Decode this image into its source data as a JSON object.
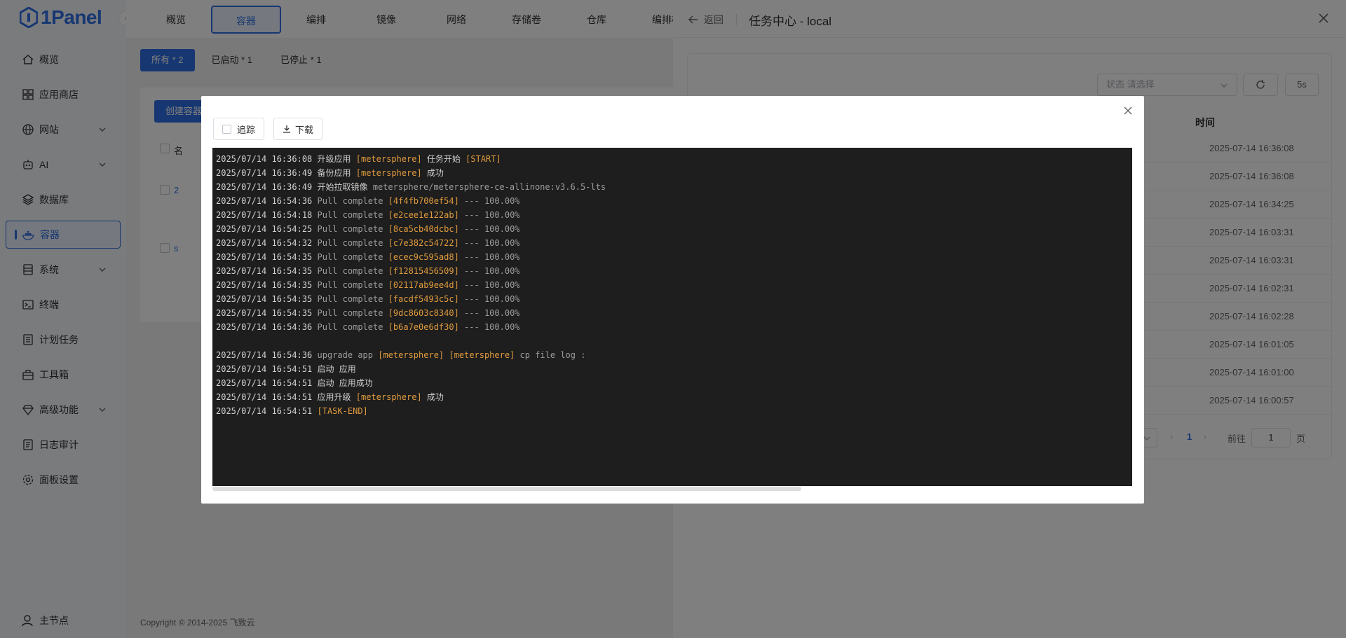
{
  "app": {
    "logo_text": "1Panel",
    "collapse_glyph": "‹"
  },
  "sidebar": {
    "items": [
      {
        "label": "概览",
        "icon": "home-icon"
      },
      {
        "label": "应用商店",
        "icon": "grid-icon"
      },
      {
        "label": "网站",
        "icon": "globe-icon",
        "has_arrow": true
      },
      {
        "label": "AI",
        "icon": "robot-icon",
        "has_arrow": true
      },
      {
        "label": "数据库",
        "icon": "layers-icon"
      },
      {
        "label": "容器",
        "icon": "docker-icon",
        "active": true
      },
      {
        "label": "系统",
        "icon": "server-icon",
        "has_arrow": true
      },
      {
        "label": "终端",
        "icon": "terminal-icon"
      },
      {
        "label": "计划任务",
        "icon": "list-icon"
      },
      {
        "label": "工具箱",
        "icon": "toolbox-icon"
      },
      {
        "label": "高级功能",
        "icon": "diamond-icon",
        "has_arrow": true
      },
      {
        "label": "日志审计",
        "icon": "log-icon"
      },
      {
        "label": "面板设置",
        "icon": "gear-icon"
      }
    ],
    "host_node": "主节点"
  },
  "topnav": {
    "tabs": [
      "概览",
      "容器",
      "编排",
      "镜像",
      "网络",
      "存储卷",
      "仓库",
      "编排模"
    ],
    "active_index": 1
  },
  "filters": {
    "all": "所有 * 2",
    "running": "已启动 * 1",
    "stopped": "已停止 * 1"
  },
  "content": {
    "create_button": "创建容器",
    "col_first": "名",
    "row1_prefix": "2",
    "row2_prefix": "s"
  },
  "footer": {
    "copyright": "Copyright © 2014-2025 飞致云"
  },
  "drawer": {
    "back_label": "返回",
    "title": "任务中心 - local",
    "status_select": "状态  请选择",
    "interval_label": "5s",
    "time_column": "时间",
    "times": [
      "2025-07-14 16:36:08",
      "2025-07-14 16:36:08",
      "2025-07-14 16:34:25",
      "2025-07-14 16:03:31",
      "2025-07-14 16:03:31",
      "2025-07-14 16:02:31",
      "2025-07-14 16:02:28",
      "2025-07-14 16:01:05",
      "2025-07-14 16:01:00",
      "2025-07-14 16:00:57"
    ],
    "pagination": {
      "prev": "‹",
      "current_page": "1",
      "next": "›",
      "goto_label": "前往",
      "goto_value": "1",
      "page_unit": "页"
    }
  },
  "dialog": {
    "follow_label": "追踪",
    "download_label": "下载",
    "log": [
      {
        "ts": "2025/07/14 16:36:08",
        "parts": [
          {
            "t": "升级应用 ",
            "c": "msg-cn"
          },
          {
            "t": "[metersphere]",
            "c": "hl"
          },
          {
            "t": " 任务开始 ",
            "c": "msg-cn"
          },
          {
            "t": "[START]",
            "c": "hl"
          }
        ]
      },
      {
        "ts": "2025/07/14 16:36:49",
        "parts": [
          {
            "t": "备份应用 ",
            "c": "msg-cn"
          },
          {
            "t": "[metersphere]",
            "c": "hl"
          },
          {
            "t": " 成功",
            "c": "msg-cn"
          }
        ]
      },
      {
        "ts": "2025/07/14 16:36:49",
        "parts": [
          {
            "t": "开始拉取镜像 ",
            "c": "msg-cn"
          },
          {
            "t": "metersphere/metersphere-ce-allinone:v3.6.5-lts",
            "c": "msg"
          }
        ]
      },
      {
        "ts": "2025/07/14 16:54:36",
        "parts": [
          {
            "t": "Pull complete ",
            "c": "msg"
          },
          {
            "t": "[4f4fb700ef54]",
            "c": "hl"
          },
          {
            "t": " --- 100.00%",
            "c": "msg"
          }
        ]
      },
      {
        "ts": "2025/07/14 16:54:18",
        "parts": [
          {
            "t": "Pull complete ",
            "c": "msg"
          },
          {
            "t": "[e2cee1e122ab]",
            "c": "hl"
          },
          {
            "t": " --- 100.00%",
            "c": "msg"
          }
        ]
      },
      {
        "ts": "2025/07/14 16:54:25",
        "parts": [
          {
            "t": "Pull complete ",
            "c": "msg"
          },
          {
            "t": "[8ca5cb40dcbc]",
            "c": "hl"
          },
          {
            "t": " --- 100.00%",
            "c": "msg"
          }
        ]
      },
      {
        "ts": "2025/07/14 16:54:32",
        "parts": [
          {
            "t": "Pull complete ",
            "c": "msg"
          },
          {
            "t": "[c7e382c54722]",
            "c": "hl"
          },
          {
            "t": " --- 100.00%",
            "c": "msg"
          }
        ]
      },
      {
        "ts": "2025/07/14 16:54:35",
        "parts": [
          {
            "t": "Pull complete ",
            "c": "msg"
          },
          {
            "t": "[ecec9c595ad8]",
            "c": "hl"
          },
          {
            "t": " --- 100.00%",
            "c": "msg"
          }
        ]
      },
      {
        "ts": "2025/07/14 16:54:35",
        "parts": [
          {
            "t": "Pull complete ",
            "c": "msg"
          },
          {
            "t": "[f12815456509]",
            "c": "hl"
          },
          {
            "t": " --- 100.00%",
            "c": "msg"
          }
        ]
      },
      {
        "ts": "2025/07/14 16:54:35",
        "parts": [
          {
            "t": "Pull complete ",
            "c": "msg"
          },
          {
            "t": "[02117ab9ee4d]",
            "c": "hl"
          },
          {
            "t": " --- 100.00%",
            "c": "msg"
          }
        ]
      },
      {
        "ts": "2025/07/14 16:54:35",
        "parts": [
          {
            "t": "Pull complete ",
            "c": "msg"
          },
          {
            "t": "[facdf5493c5c]",
            "c": "hl"
          },
          {
            "t": " --- 100.00%",
            "c": "msg"
          }
        ]
      },
      {
        "ts": "2025/07/14 16:54:35",
        "parts": [
          {
            "t": "Pull complete ",
            "c": "msg"
          },
          {
            "t": "[9dc8603c8340]",
            "c": "hl"
          },
          {
            "t": " --- 100.00%",
            "c": "msg"
          }
        ]
      },
      {
        "ts": "2025/07/14 16:54:36",
        "parts": [
          {
            "t": "Pull complete ",
            "c": "msg"
          },
          {
            "t": "[b6a7e0e6df30]",
            "c": "hl"
          },
          {
            "t": " --- 100.00%",
            "c": "msg"
          }
        ]
      },
      {
        "ts": "",
        "parts": []
      },
      {
        "ts": "2025/07/14 16:54:36",
        "parts": [
          {
            "t": "upgrade app ",
            "c": "msg"
          },
          {
            "t": "[metersphere]",
            "c": "hl"
          },
          {
            "t": " ",
            "c": "msg"
          },
          {
            "t": "[metersphere]",
            "c": "hl"
          },
          {
            "t": " cp file log :",
            "c": "msg"
          }
        ]
      },
      {
        "ts": "2025/07/14 16:54:51",
        "parts": [
          {
            "t": "启动 应用",
            "c": "msg-cn"
          }
        ]
      },
      {
        "ts": "2025/07/14 16:54:51",
        "parts": [
          {
            "t": "启动 应用成功",
            "c": "msg-cn"
          }
        ]
      },
      {
        "ts": "2025/07/14 16:54:51",
        "parts": [
          {
            "t": "应用升级 ",
            "c": "msg-cn"
          },
          {
            "t": "[metersphere]",
            "c": "hl"
          },
          {
            "t": " 成功",
            "c": "msg-cn"
          }
        ]
      },
      {
        "ts": "2025/07/14 16:54:51",
        "parts": [
          {
            "t": "[TASK-END]",
            "c": "hl"
          }
        ]
      }
    ]
  },
  "colors": {
    "accent": "#2f6fe4",
    "log_bg": "#1e1e1e",
    "log_highlight": "#e09b3d",
    "overlay": "rgba(0,0,0,0.5)"
  }
}
